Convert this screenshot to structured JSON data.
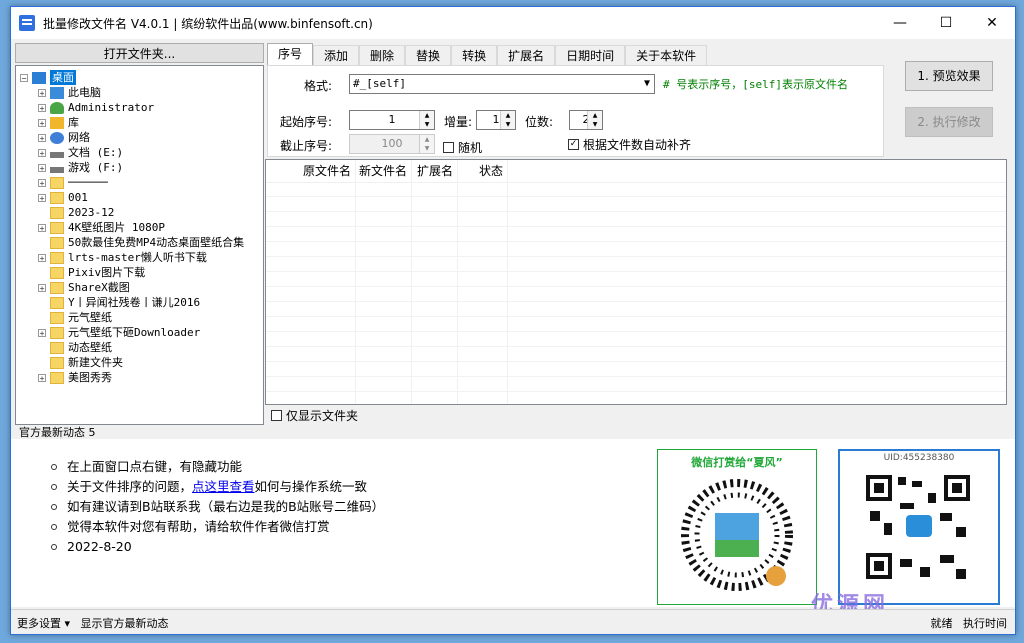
{
  "window": {
    "title": "批量修改文件名 V4.0.1 | 缤纷软件出品(www.binfensoft.cn)",
    "minimize": "—",
    "maximize": "☐",
    "close": "✕"
  },
  "left": {
    "open_folder": "打开文件夹...",
    "tree": [
      {
        "label": "桌面",
        "icon": "desktop-icon",
        "pm": "−",
        "indent": 0,
        "selected": true
      },
      {
        "label": "此电脑",
        "icon": "pc-icon",
        "pm": "+",
        "indent": 1
      },
      {
        "label": "Administrator",
        "icon": "user-icon",
        "pm": "+",
        "indent": 1
      },
      {
        "label": "库",
        "icon": "library-icon",
        "pm": "+",
        "indent": 1
      },
      {
        "label": "网络",
        "icon": "network-icon",
        "pm": "+",
        "indent": 1
      },
      {
        "label": "文档 (E:)",
        "icon": "drive-icon",
        "pm": "+",
        "indent": 1
      },
      {
        "label": "游戏 (F:)",
        "icon": "drive-icon",
        "pm": "+",
        "indent": 1
      },
      {
        "label": "──────",
        "icon": "folder-icon",
        "pm": "+",
        "indent": 1
      },
      {
        "label": "001",
        "icon": "folder-icon",
        "pm": "+",
        "indent": 1
      },
      {
        "label": "2023-12",
        "icon": "folder-icon",
        "pm": "",
        "indent": 1
      },
      {
        "label": "4K壁纸图片 1080P",
        "icon": "folder-icon",
        "pm": "+",
        "indent": 1
      },
      {
        "label": "50款最佳免费MP4动态桌面壁纸合集",
        "icon": "folder-icon",
        "pm": "",
        "indent": 1
      },
      {
        "label": "lrts-master懒人听书下载",
        "icon": "folder-icon",
        "pm": "+",
        "indent": 1
      },
      {
        "label": "Pixiv图片下载",
        "icon": "folder-icon",
        "pm": "",
        "indent": 1
      },
      {
        "label": "ShareX截图",
        "icon": "folder-icon",
        "pm": "+",
        "indent": 1
      },
      {
        "label": "Y丨异闻社残卷丨谦儿2016",
        "icon": "folder-icon",
        "pm": "",
        "indent": 1
      },
      {
        "label": "元气壁纸",
        "icon": "folder-icon",
        "pm": "",
        "indent": 1
      },
      {
        "label": "元气壁纸下砸Downloader",
        "icon": "folder-icon",
        "pm": "+",
        "indent": 1
      },
      {
        "label": "动态壁纸",
        "icon": "folder-icon",
        "pm": "",
        "indent": 1
      },
      {
        "label": "新建文件夹",
        "icon": "folder-icon",
        "pm": "",
        "indent": 1
      },
      {
        "label": "美图秀秀",
        "icon": "folder-icon",
        "pm": "+",
        "indent": 1
      }
    ]
  },
  "tabs": [
    "序号",
    "添加",
    "删除",
    "替换",
    "转换",
    "扩展名",
    "日期时间",
    "关于本软件"
  ],
  "form": {
    "format_label": "格式:",
    "format_value": "#_[self]",
    "hint": "# 号表示序号，[self]表示原文件名",
    "start_label": "起始序号:",
    "start_value": "1",
    "inc_label": "增量:",
    "inc_value": "1",
    "digits_label": "位数:",
    "digits_value": "2",
    "end_label": "截止序号:",
    "end_value": "100",
    "random_label": "随机",
    "auto_pad_label": "根据文件数自动补齐"
  },
  "buttons": {
    "preview": "1. 预览效果",
    "execute": "2. 执行修改"
  },
  "table": {
    "columns": [
      "原文件名",
      "新文件名",
      "扩展名",
      "状态"
    ]
  },
  "only_folders": "仅显示文件夹",
  "news": {
    "label": "官方最新动态 5",
    "items": [
      {
        "pre": "在上面窗口点右键，有隐藏功能",
        "link": "",
        "post": ""
      },
      {
        "pre": "关于文件排序的问题，",
        "link": "点这里查看",
        "post": "如何与操作系统一致"
      },
      {
        "pre": "如有建议请到B站联系我（最右边是我的B站账号二维码）",
        "link": "",
        "post": ""
      },
      {
        "pre": "觉得本软件对您有帮助，请给软件作者微信打赏",
        "link": "",
        "post": ""
      },
      {
        "pre": "2022-8-20",
        "link": "",
        "post": ""
      }
    ],
    "wechat_title": "微信打赏给“夏风”",
    "uid": "UID:455238380"
  },
  "status": {
    "more_settings": "更多设置 ▾",
    "show_news": "显示官方最新动态",
    "ready": "就绪",
    "exec_time": "执行时间"
  },
  "watermark": "优源网"
}
